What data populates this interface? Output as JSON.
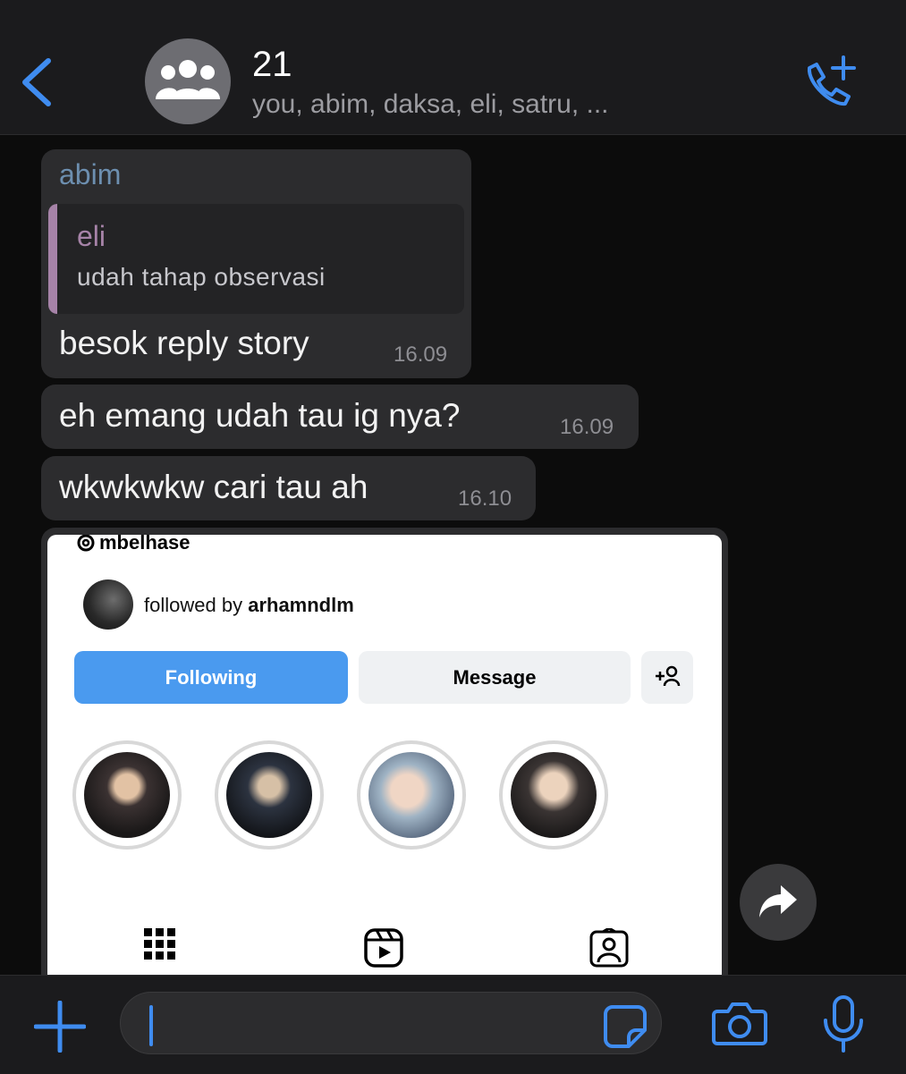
{
  "header": {
    "title": "21",
    "members": "you, abim, daksa, eli, satru, ...",
    "back_icon": "chevron-left-icon",
    "avatar_icon": "group-icon",
    "call_icon": "phone-add-icon"
  },
  "messages": [
    {
      "sender": "abim",
      "quote": {
        "name": "eli",
        "text": "udah tahap observasi"
      },
      "text": "besok reply story",
      "time": "16.09"
    },
    {
      "text": "eh emang udah tau ig nya?",
      "time": "16.09"
    },
    {
      "text": "wkwkwkw cari tau ah",
      "time": "16.10"
    }
  ],
  "image_message": {
    "username": "mbelhase",
    "followed_prefix": "followed by",
    "followed_user": "arhamndlm",
    "following_label": "Following",
    "message_label": "Message",
    "add_user_icon": "add-user-icon",
    "highlights_count": 4,
    "tabs": [
      "grid-icon",
      "reels-icon",
      "tagged-icon"
    ]
  },
  "input_bar": {
    "plus_icon": "plus-icon",
    "sticker_icon": "sticker-icon",
    "camera_icon": "camera-icon",
    "mic_icon": "microphone-icon"
  },
  "colors": {
    "accent": "#3f8cf0",
    "bubble": "#2c2c2e",
    "sender": "#6d8fb0",
    "quote_accent": "#a683a8",
    "ig_blue": "#4a9aef"
  }
}
